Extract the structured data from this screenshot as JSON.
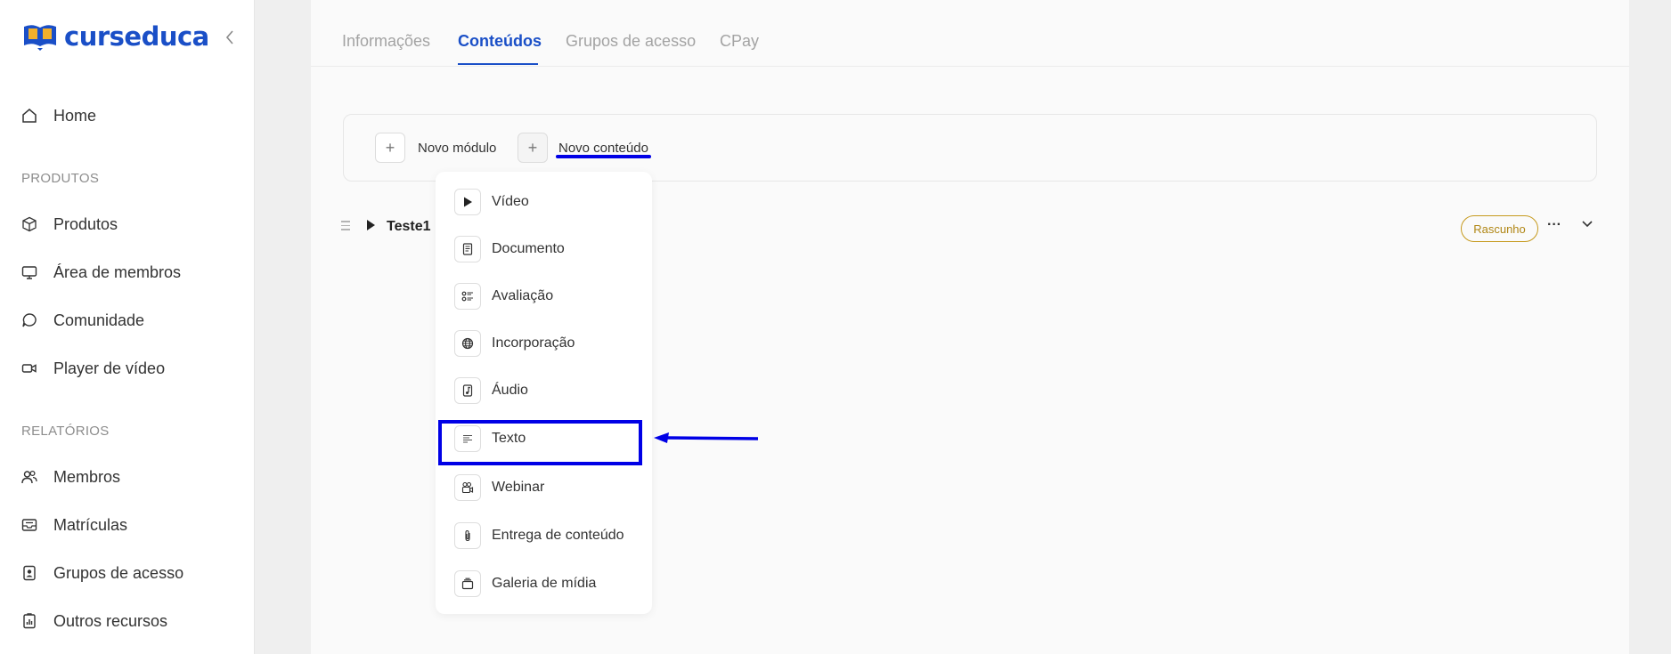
{
  "brand": {
    "name": "curseduca",
    "color": "#1a4fc7"
  },
  "sidebar": {
    "collapse_icon": "chevron-left-icon",
    "home": {
      "label": "Home",
      "icon": "home-icon"
    },
    "sections": [
      {
        "label": "PRODUTOS",
        "items": [
          {
            "label": "Produtos",
            "icon": "box-icon"
          },
          {
            "label": "Área de membros",
            "icon": "monitor-icon"
          },
          {
            "label": "Comunidade",
            "icon": "chat-icon"
          },
          {
            "label": "Player de vídeo",
            "icon": "video-camera-icon"
          }
        ]
      },
      {
        "label": "RELATÓRIOS",
        "items": [
          {
            "label": "Membros",
            "icon": "users-icon"
          },
          {
            "label": "Matrículas",
            "icon": "inbox-icon"
          },
          {
            "label": "Grupos de acesso",
            "icon": "badge-icon"
          },
          {
            "label": "Outros recursos",
            "icon": "report-icon"
          }
        ]
      }
    ]
  },
  "tabs": [
    {
      "label": "Informações",
      "active": false
    },
    {
      "label": "Conteúdos",
      "active": true
    },
    {
      "label": "Grupos de acesso",
      "active": false
    },
    {
      "label": "CPay",
      "active": false
    }
  ],
  "actions": {
    "new_module": "Novo módulo",
    "new_content": "Novo conteúdo",
    "plus_glyph": "+"
  },
  "module": {
    "title": "Teste1",
    "status": "Rascunho",
    "more": "···",
    "status_color": "#c69a1e"
  },
  "dropdown": {
    "items": [
      {
        "label": "Vídeo",
        "icon": "play-icon"
      },
      {
        "label": "Documento",
        "icon": "document-icon"
      },
      {
        "label": "Avaliação",
        "icon": "checklist-icon"
      },
      {
        "label": "Incorporação",
        "icon": "globe-icon"
      },
      {
        "label": "Áudio",
        "icon": "music-note-icon"
      },
      {
        "label": "Texto",
        "icon": "text-lines-icon",
        "highlighted": true
      },
      {
        "label": "Webinar",
        "icon": "webinar-camera-icon"
      },
      {
        "label": "Entrega de conteúdo",
        "icon": "paperclip-icon"
      },
      {
        "label": "Galeria de mídia",
        "icon": "gallery-icon"
      }
    ]
  },
  "annotation_color": "#0000e6"
}
